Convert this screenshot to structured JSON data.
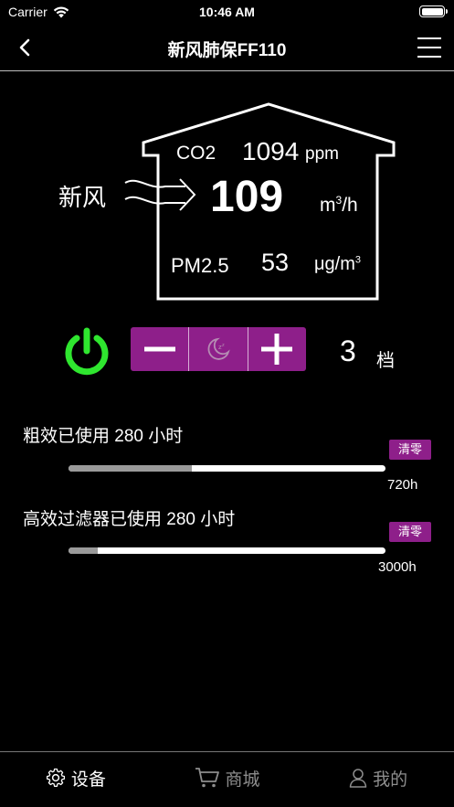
{
  "status_bar": {
    "carrier": "Carrier",
    "time": "10:46 AM",
    "battery_level": 1.0
  },
  "nav": {
    "title": "新风肺保FF110"
  },
  "readings": {
    "co2_label": "CO2",
    "co2_value": "1094",
    "co2_unit": "ppm",
    "fresh_air_label": "新风",
    "airflow_value": "109",
    "airflow_unit_base": "m",
    "airflow_unit_exp": "3",
    "airflow_unit_tail": "/h",
    "pm_label": "PM2.5",
    "pm_value": "53",
    "pm_unit_base": "μg/m",
    "pm_unit_exp": "3"
  },
  "controls": {
    "level_value": "3",
    "level_unit": "档"
  },
  "filters": [
    {
      "label": "粗效已使用 280 小时",
      "clear_label": "清零",
      "max_label": "720h",
      "used_fraction": 0.39
    },
    {
      "label": "高效过滤器已使用 280 小时",
      "clear_label": "清零",
      "max_label": "3000h",
      "used_fraction": 0.093
    }
  ],
  "colors": {
    "accent": "#8e1f8a",
    "power": "#2fe62f",
    "background": "#000000"
  },
  "tabs": [
    {
      "label": "设备",
      "icon": "gear-icon",
      "active": true
    },
    {
      "label": "商城",
      "icon": "cart-icon",
      "active": false
    },
    {
      "label": "我的",
      "icon": "person-icon",
      "active": false
    }
  ]
}
